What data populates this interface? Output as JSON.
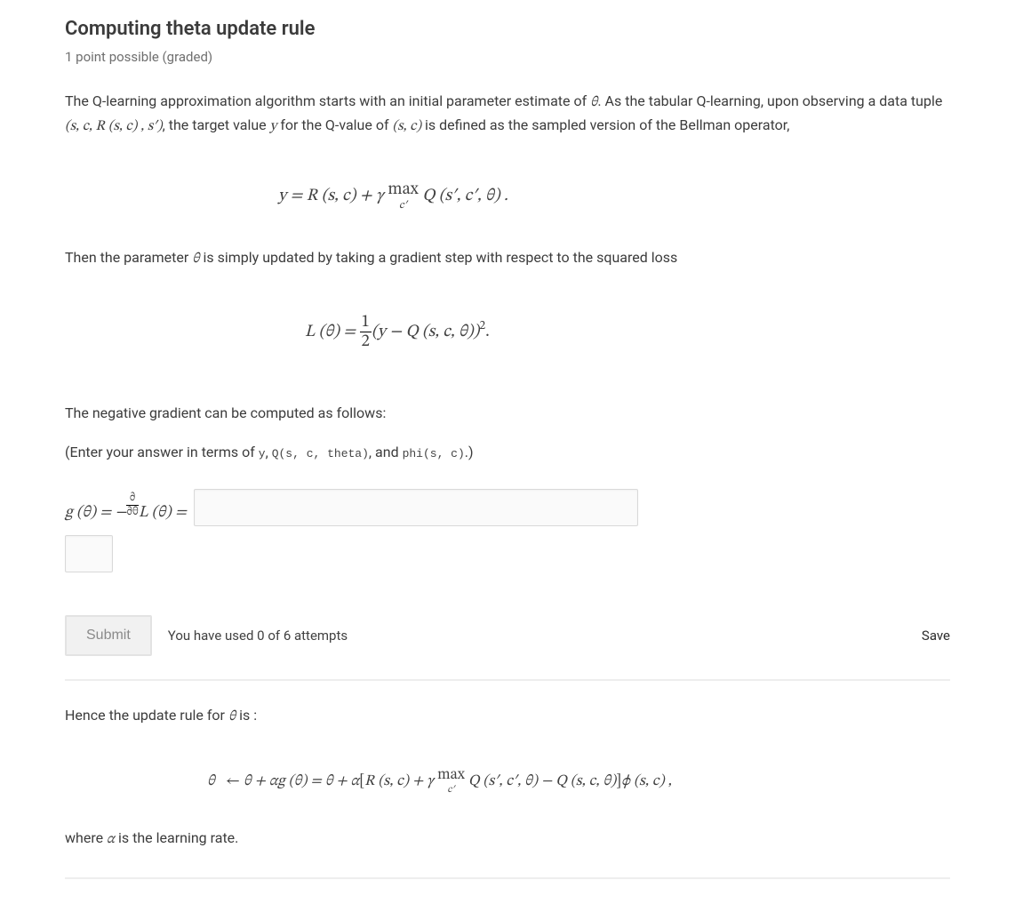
{
  "title": "Computing theta update rule",
  "points_label": "1 point possible (graded)",
  "para1_a": "The Q-learning approximation algorithm starts with an initial parameter estimate of ",
  "theta_sym": "θ",
  "para1_b": ". As the tabular Q-learning, upon observing a data tuple ",
  "tuple_math": "(s, c, R (s, c) , s′)",
  "para1_c": ", the target value ",
  "y_sym": "y",
  "para1_d": " for the Q-value of ",
  "sc_math": "(s, c)",
  "para1_e": " is defined as the sampled version of the Bellman operator,",
  "eq1": {
    "lhs": "y = R (s, c) + γ ",
    "max_top": "max",
    "max_bot": "c′",
    "rhs": " Q (s′, c′, θ) ."
  },
  "para2_a": "Then the parameter ",
  "para2_b": " is simply updated by taking a gradient step with respect to the squared loss",
  "eq2": {
    "lhs": "L (θ) = ",
    "frac_num": "1",
    "frac_den": "2",
    "mid": "(y − Q (s, c, θ))",
    "sup": "2",
    "end": "."
  },
  "para3": "The negative gradient can be computed as follows:",
  "hint_a": "(Enter your answer in terms of ",
  "hint_terms": [
    "y",
    "Q(s, c, theta)",
    "phi(s, c)"
  ],
  "hint_and": ", and ",
  "hint_sep": ", ",
  "hint_end": ".)",
  "answer_prefix": {
    "g": "g (θ) = −",
    "partial_num": "∂",
    "partial_den": "∂θ",
    "L": "L (θ) = "
  },
  "submit_label": "Submit",
  "attempts_text": "You have used 0 of 6 attempts",
  "save_label": "Save",
  "para4_a": "Hence the update rule for ",
  "para4_b": " is :",
  "eq3": {
    "theta": "θ",
    "arrow": "←",
    "a": " θ + αg (θ) = θ + α",
    "lb": "[",
    "b": "R (s, c) + γ ",
    "max_top": "max",
    "max_bot": "c′",
    "c": " Q (s′, c′, θ) − Q (s, c, θ)",
    "rb": "]",
    "d": "ϕ (s, c) ,"
  },
  "para5_a": "where ",
  "alpha_sym": "α",
  "para5_b": " is the learning rate."
}
